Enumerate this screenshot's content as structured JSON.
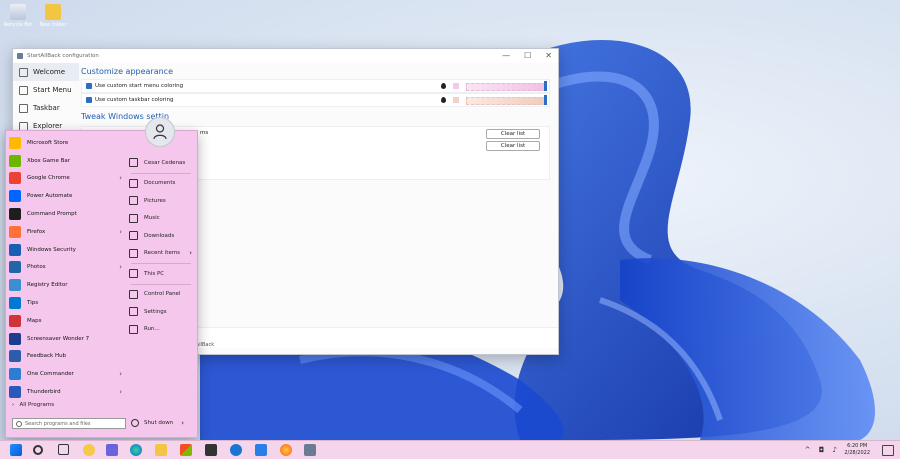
{
  "desktop": {
    "icons": [
      {
        "label": "Recycle Bin",
        "icon": "recycle-bin-icon"
      },
      {
        "label": "New folder",
        "icon": "folder-icon"
      }
    ]
  },
  "config_window": {
    "title": "StartAllBack configuration",
    "controls": {
      "minimize": "—",
      "maximize": "☐",
      "close": "✕"
    },
    "sidebar": [
      {
        "label": "Welcome",
        "selected": true
      },
      {
        "label": "Start Menu"
      },
      {
        "label": "Taskbar"
      },
      {
        "label": "Explorer"
      }
    ],
    "customize_heading": "Customize appearance",
    "options": [
      {
        "label": "Use custom start menu coloring",
        "checked": true,
        "swatch": "#f6c7ec"
      },
      {
        "label": "Use custom taskbar coloring",
        "checked": true,
        "swatch": "#f4d0c5"
      }
    ],
    "tweak_heading": "Tweak Windows settin",
    "tweak_row_text": "ms",
    "buttons": {
      "clear1": "Clear list",
      "clear2": "Clear list"
    },
    "footer": "go to Control Panel - StartAllBack"
  },
  "start_menu": {
    "apps": [
      {
        "label": "Microsoft Store",
        "color": "#ffb900"
      },
      {
        "label": "Xbox Game Bar",
        "color": "#6bb700"
      },
      {
        "label": "Google Chrome",
        "color": "#ea4335",
        "arrow": true
      },
      {
        "label": "Power Automate",
        "color": "#0066ff"
      },
      {
        "label": "Command Prompt",
        "color": "#1e1e1e"
      },
      {
        "label": "Firefox",
        "color": "#ff7139",
        "arrow": true
      },
      {
        "label": "Windows Security",
        "color": "#1a5fb4"
      },
      {
        "label": "Photos",
        "color": "#2266aa",
        "arrow": true
      },
      {
        "label": "Registry Editor",
        "color": "#3b8ed0"
      },
      {
        "label": "Tips",
        "color": "#0078d4"
      },
      {
        "label": "Maps",
        "color": "#d13438"
      },
      {
        "label": "Screensaver Wonder 7",
        "color": "#1c3d8f"
      },
      {
        "label": "Feedback Hub",
        "color": "#2b5dab"
      },
      {
        "label": "One Commander",
        "color": "#2d7dd2",
        "arrow": true
      },
      {
        "label": "Thunderbird",
        "color": "#2a5ab8",
        "arrow": true
      }
    ],
    "all_programs": "All Programs",
    "search_placeholder": "Search programs and files",
    "right": [
      {
        "label": "Cesar Cedenas"
      },
      {
        "label": "Documents"
      },
      {
        "label": "Pictures"
      },
      {
        "label": "Music"
      },
      {
        "label": "Downloads"
      },
      {
        "label": "Recent items",
        "arrow": true
      },
      {
        "label": "This PC"
      },
      {
        "label": "Control Panel"
      },
      {
        "label": "Settings"
      },
      {
        "label": "Run..."
      }
    ],
    "shutdown": "Shut down"
  },
  "taskbar": {
    "time": "6:20 PM",
    "date": "2/28/2022",
    "tray_icons": "^ ◘ ♪"
  }
}
